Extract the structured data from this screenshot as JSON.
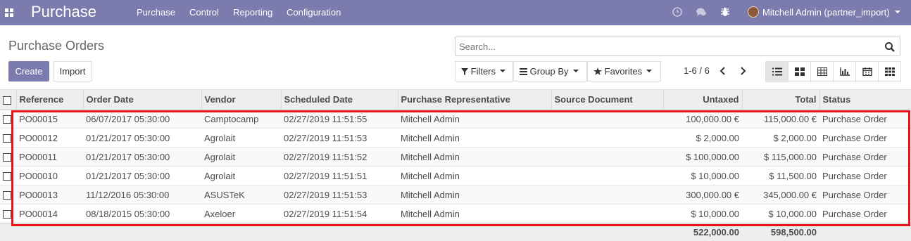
{
  "navbar": {
    "app_name": "Purchase",
    "menu": [
      "Purchase",
      "Control",
      "Reporting",
      "Configuration"
    ],
    "user": "Mitchell Admin (partner_import)"
  },
  "control_panel": {
    "title": "Purchase Orders",
    "create_label": "Create",
    "import_label": "Import",
    "search_placeholder": "Search...",
    "filters_label": "Filters",
    "groupby_label": "Group By",
    "favorites_label": "Favorites",
    "pager": "1-6 / 6"
  },
  "table": {
    "columns": [
      "Reference",
      "Order Date",
      "Vendor",
      "Scheduled Date",
      "Purchase Representative",
      "Source Document",
      "Untaxed",
      "Total",
      "Status"
    ],
    "rows": [
      [
        "PO00015",
        "06/07/2017 05:30:00",
        "Camptocamp",
        "02/27/2019 11:51:55",
        "Mitchell Admin",
        "",
        "100,000.00 €",
        "115,000.00 €",
        "Purchase Order"
      ],
      [
        "PO00012",
        "01/21/2017 05:30:00",
        "Agrolait",
        "02/27/2019 11:51:53",
        "Mitchell Admin",
        "",
        "$ 2,000.00",
        "$ 2,000.00",
        "Purchase Order"
      ],
      [
        "PO00011",
        "01/21/2017 05:30:00",
        "Agrolait",
        "02/27/2019 11:51:52",
        "Mitchell Admin",
        "",
        "$ 100,000.00",
        "$ 115,000.00",
        "Purchase Order"
      ],
      [
        "PO00010",
        "01/21/2017 05:30:00",
        "Agrolait",
        "02/27/2019 11:51:51",
        "Mitchell Admin",
        "",
        "$ 10,000.00",
        "$ 11,500.00",
        "Purchase Order"
      ],
      [
        "PO00013",
        "11/12/2016 05:30:00",
        "ASUSTeK",
        "02/27/2019 11:51:53",
        "Mitchell Admin",
        "",
        "300,000.00 €",
        "345,000.00 €",
        "Purchase Order"
      ],
      [
        "PO00014",
        "08/18/2015 05:30:00",
        "Axeloer",
        "02/27/2019 11:51:54",
        "Mitchell Admin",
        "",
        "$ 10,000.00",
        "$ 10,000.00",
        "Purchase Order"
      ]
    ],
    "footer": {
      "untaxed": "522,000.00",
      "total": "598,500.00"
    }
  },
  "colors": {
    "brand": "#7c7bad",
    "highlight": "#e8121b"
  }
}
